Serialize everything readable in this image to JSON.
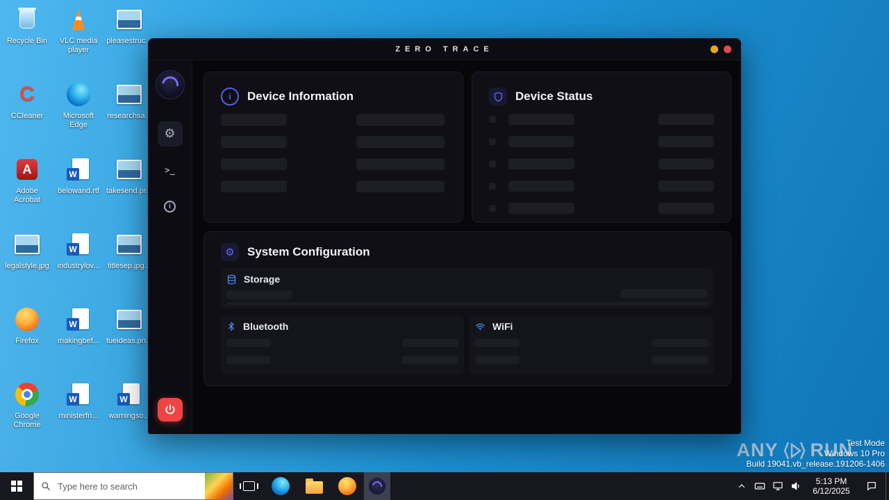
{
  "desktop": {
    "icons": [
      {
        "label": "Recycle Bin",
        "type": "recycle"
      },
      {
        "label": "VLC media player",
        "type": "vlc"
      },
      {
        "label": "pleasestruc...",
        "type": "image"
      },
      {
        "label": "CCleaner",
        "type": "ccleaner"
      },
      {
        "label": "Microsoft Edge",
        "type": "edge"
      },
      {
        "label": "researchsa...",
        "type": "image"
      },
      {
        "label": "Adobe Acrobat",
        "type": "acrobat"
      },
      {
        "label": "belowand.rtf",
        "type": "word"
      },
      {
        "label": "takesend.pr...",
        "type": "image"
      },
      {
        "label": "legalstyle.jpg",
        "type": "image"
      },
      {
        "label": "industrylov...",
        "type": "word"
      },
      {
        "label": "titlesep.jpg...",
        "type": "image"
      },
      {
        "label": "Firefox",
        "type": "firefox"
      },
      {
        "label": "makingbef...",
        "type": "word"
      },
      {
        "label": "tueideas.pn...",
        "type": "image"
      },
      {
        "label": "Google Chrome",
        "type": "chrome"
      },
      {
        "label": "ministerfri...",
        "type": "word"
      },
      {
        "label": "warningso...",
        "type": "image"
      }
    ]
  },
  "app": {
    "title": "ZERO TRACE",
    "cards": {
      "device_information": "Device Information",
      "device_status": "Device Status",
      "system_configuration": "System Configuration",
      "storage": "Storage",
      "bluetooth": "Bluetooth",
      "wifi": "WiFi"
    },
    "colors": {
      "accent": "#6366f1",
      "power_button": "#ef4444",
      "dot_yellow": "#eda71c",
      "dot_red": "#e5484d"
    }
  },
  "watermark": {
    "any": "ANY",
    "run": "RUN",
    "test_mode": "Test Mode",
    "os": "Windows 10 Pro",
    "build": "Build 19041.vb_release.191206-1406"
  },
  "taskbar": {
    "search_placeholder": "Type here to search",
    "clock": {
      "time": "5:13 PM",
      "date": "6/12/2025"
    }
  }
}
